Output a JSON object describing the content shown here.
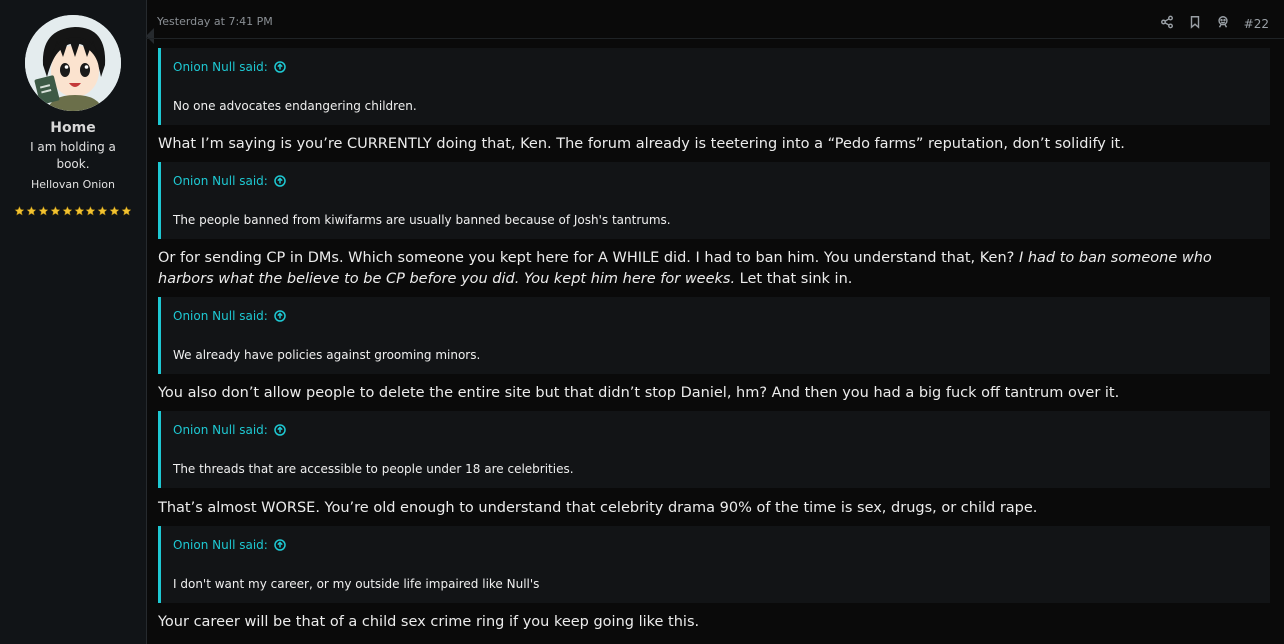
{
  "user": {
    "name": "Home",
    "title": "I am holding a book.",
    "banner": "Hellovan Onion",
    "star_count": 10
  },
  "post": {
    "timestamp": "Yesterday at 7:41 PM",
    "number": "#22",
    "action_icons": [
      "share-icon",
      "bookmark-icon",
      "react-icon"
    ]
  },
  "blocks": [
    {
      "quote_author": "Onion Null said:",
      "quote_text": "No one advocates endangering children.",
      "reply": "What I’m saying is you’re CURRENTLY doing that, Ken. The forum already is teetering into a “Pedo farms” reputation, don’t solidify it."
    },
    {
      "quote_author": "Onion Null said:",
      "quote_text": "The people banned from kiwifarms are usually banned because of Josh's tantrums.",
      "reply_plain": "Or for sending CP in DMs. Which someone you kept here for A WHILE did. I had to ban him. You understand that, Ken? ",
      "reply_italic": "I had to ban someone who harbors what the believe to be CP before you did. You kept him here for weeks.",
      "reply_tail": " Let that sink in."
    },
    {
      "quote_author": "Onion Null said:",
      "quote_text": "We already have policies against grooming minors.",
      "reply": "You also don’t allow people to delete the entire site but that didn’t stop Daniel, hm? And then you had a big fuck off tantrum over it."
    },
    {
      "quote_author": "Onion Null said:",
      "quote_text": "The threads that are accessible to people under 18 are celebrities.",
      "reply": "That’s almost WORSE. You’re old enough to understand that celebrity drama 90% of the time is sex, drugs, or child rape."
    },
    {
      "quote_author": "Onion Null said:",
      "quote_text": "I don't want my career, or my outside life impaired like Null's",
      "reply": "Your career will be that of a child sex crime ring if you keep going like this."
    }
  ],
  "colors": {
    "accent": "#1ec8d2",
    "background": "#0a0a0a",
    "quote_bg": "#121416",
    "star": "#f2c230"
  }
}
